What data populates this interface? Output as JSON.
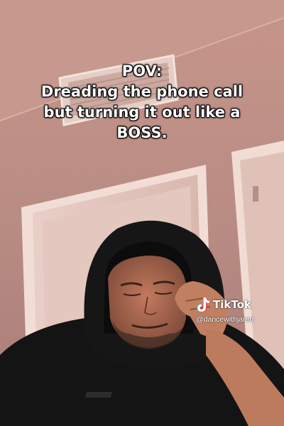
{
  "caption": {
    "line1": "POV:",
    "line2": "Dreading the phone call",
    "line3": "but turning it out like a",
    "line4": "BOSS."
  },
  "watermark": {
    "brand": "TikTok",
    "handle": "@dancewithjared",
    "logo_icon": "tiktok-note-icon"
  },
  "colors": {
    "wall": "#b9897f",
    "ceiling": "#c49388",
    "door_frame": "#f2ddd6",
    "hoodie": "#161616",
    "caption_text": "#ffffff"
  }
}
